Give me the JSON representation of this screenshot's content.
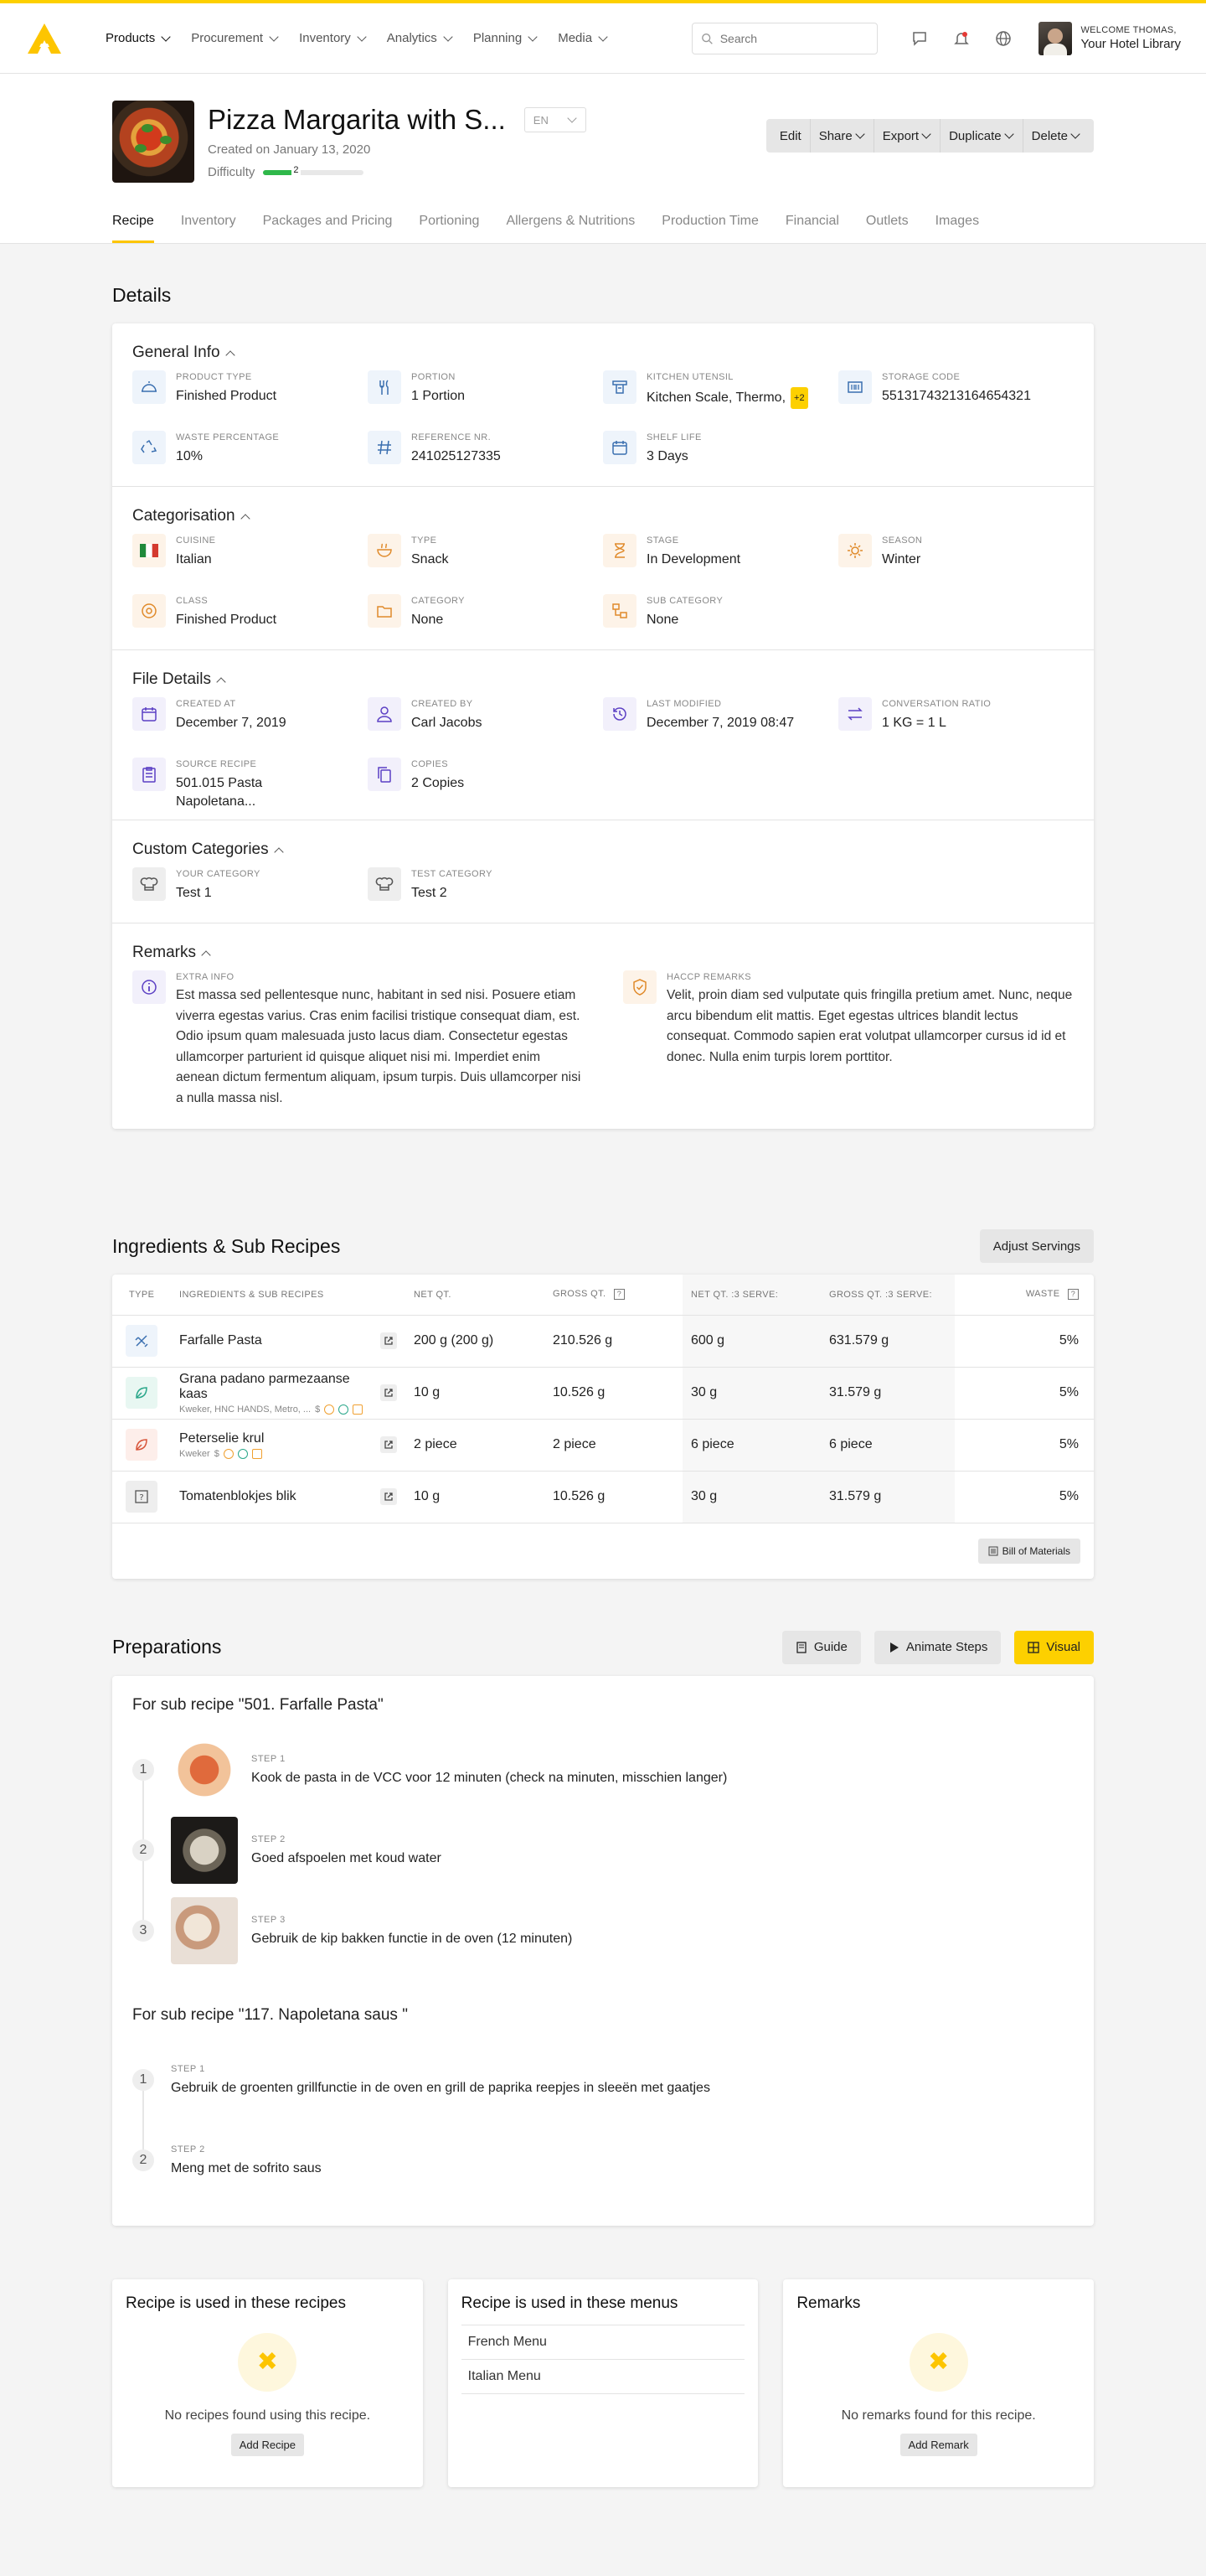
{
  "brand": {
    "accent": "#fdd000",
    "success": "#2fb84a"
  },
  "nav": {
    "items": [
      {
        "label": "Products"
      },
      {
        "label": "Procurement"
      },
      {
        "label": "Inventory"
      },
      {
        "label": "Analytics"
      },
      {
        "label": "Planning"
      },
      {
        "label": "Media"
      }
    ]
  },
  "search": {
    "placeholder": "Search"
  },
  "user": {
    "welcome": "WELCOME THOMAS,",
    "name": "Your Hotel Library"
  },
  "recipe": {
    "title": "Pizza Margarita with S...",
    "created": "Created on January 13, 2020",
    "difficulty_label": "Difficulty",
    "difficulty_value": "2",
    "difficulty_fraction": 0.35,
    "language": "EN",
    "actions": [
      "Edit",
      "Share",
      "Export",
      "Duplicate",
      "Delete"
    ],
    "tabs": [
      "Recipe",
      "Inventory",
      "Packages and Pricing",
      "Portioning",
      "Allergens & Nutritions",
      "Production Time",
      "Financial",
      "Outlets",
      "Images"
    ]
  },
  "details": {
    "title": "Details",
    "general": {
      "title": "General Info",
      "fields": [
        {
          "label": "PRODUCT TYPE",
          "value": "Finished Product",
          "icon": "dome-icon"
        },
        {
          "label": "PORTION",
          "value": "1 Portion",
          "icon": "cutlery-icon"
        },
        {
          "label": "KITCHEN UTENSIL",
          "value": "Kitchen Scale, Thermo,",
          "badge": "+2",
          "icon": "utensil-icon"
        },
        {
          "label": "STORAGE CODE",
          "value": "55131743213164654321",
          "icon": "barcode-icon"
        },
        {
          "label": "WASTE PERCENTAGE",
          "value": "10%",
          "icon": "recycle-icon"
        },
        {
          "label": "REFERENCE NR.",
          "value": "241025127335",
          "icon": "hash-icon"
        },
        {
          "label": "SHELF LIFE",
          "value": "3 Days",
          "icon": "calendar-icon"
        }
      ]
    },
    "categorisation": {
      "title": "Categorisation",
      "fields": [
        {
          "label": "CUISINE",
          "value": "Italian",
          "icon": "flag-italy-icon"
        },
        {
          "label": "TYPE",
          "value": "Snack",
          "icon": "bowl-icon"
        },
        {
          "label": "STAGE",
          "value": "In Development",
          "icon": "hourglass-icon"
        },
        {
          "label": "SEASON",
          "value": "Winter",
          "icon": "sun-icon"
        },
        {
          "label": "CLASS",
          "value": "Finished Product",
          "icon": "badge-icon"
        },
        {
          "label": "CATEGORY",
          "value": "None",
          "icon": "folder-icon"
        },
        {
          "label": "SUB CATEGORY",
          "value": "None",
          "icon": "hierarchy-icon"
        }
      ]
    },
    "file": {
      "title": "File Details",
      "fields": [
        {
          "label": "CREATED AT",
          "value": "December 7, 2019",
          "icon": "calendar-icon"
        },
        {
          "label": "CREATED BY",
          "value": "Carl Jacobs",
          "icon": "user-icon"
        },
        {
          "label": "LAST MODIFIED",
          "value": "December 7, 2019 08:47",
          "icon": "history-icon"
        },
        {
          "label": "CONVERSATION RATIO",
          "value": "1 KG = 1 L",
          "icon": "swap-icon"
        },
        {
          "label": "SOURCE RECIPE",
          "value": "501.015 Pasta Napoletana...",
          "icon": "clipboard-icon"
        },
        {
          "label": "COPIES",
          "value": "2 Copies",
          "icon": "copy-icon"
        }
      ]
    },
    "custom": {
      "title": "Custom Categories",
      "fields": [
        {
          "label": "YOUR CATEGORY",
          "value": "Test 1",
          "icon": "chef-hat-icon"
        },
        {
          "label": "TEST CATEGORY",
          "value": "Test 2",
          "icon": "chef-hat-icon"
        }
      ]
    },
    "remarks": {
      "title": "Remarks",
      "items": [
        {
          "label": "EXTRA INFO",
          "text": "Est massa sed pellentesque nunc, habitant in sed nisi. Posuere etiam viverra egestas varius. Cras enim facilisi tristique consequat diam, est. Odio ipsum quam malesuada justo lacus diam. Consectetur egestas ullamcorper parturient id quisque aliquet nisi mi. Imperdiet enim aenean dictum fermentum aliquam, ipsum turpis. Duis ullamcorper nisi a nulla massa nisl.",
          "icon": "info-icon"
        },
        {
          "label": "HACCP REMARKS",
          "text": "Velit, proin diam sed vulputate quis fringilla pretium amet. Nunc, neque arcu bibendum elit mattis. Eget egestas ultrices blandit lectus consequat. Commodo sapien erat volutpat ullamcorper cursus id id et donec. Nulla enim turpis lorem porttitor.",
          "icon": "shield-check-icon"
        }
      ]
    }
  },
  "ingredients": {
    "title": "Ingredients & Sub Recipes",
    "adjust_label": "Adjust Servings",
    "headers": [
      "TYPE",
      "INGREDIENTS & SUB RECIPES",
      "NET QT.",
      "GROSS QT.",
      "NET QT. :3 SERVE:",
      "GROSS QT. :3 SERVE:",
      "WASTE"
    ],
    "rows": [
      {
        "name": "Farfalle Pasta",
        "sub": "",
        "net": "200 g (200 g)",
        "gross": "210.526 g",
        "net3": "600 g",
        "gross3": "631.579 g",
        "waste": "5%",
        "icon": "pasta-icon",
        "tint": "#eef4fb"
      },
      {
        "name": "Grana padano parmezaanse kaas",
        "sub": "Kweker, HNC HANDS, Metro, ...",
        "net": "10 g",
        "gross": "10.526 g",
        "net3": "30 g",
        "gross3": "31.579 g",
        "waste": "5%",
        "icon": "leaf-icon",
        "tint": "#e8f7f2"
      },
      {
        "name": "Peterselie krul",
        "sub": "Kweker",
        "net": "2 piece",
        "gross": "2 piece",
        "net3": "6 piece",
        "gross3": "6 piece",
        "waste": "5%",
        "icon": "leaf-icon",
        "tint": "#fdeeea"
      },
      {
        "name": "Tomatenblokjes blik",
        "sub": "",
        "net": "10 g",
        "gross": "10.526 g",
        "net3": "30 g",
        "gross3": "31.579 g",
        "waste": "5%",
        "icon": "question-icon",
        "tint": "#eeeeee"
      }
    ],
    "bom_label": "Bill of Materials"
  },
  "preparations": {
    "title": "Preparations",
    "guide_label": "Guide",
    "animate_label": "Animate Steps",
    "visual_label": "Visual",
    "groups": [
      {
        "title": "For sub recipe \"501. Farfalle Pasta\"",
        "steps": [
          {
            "num": "1",
            "label": "STEP 1",
            "text": "Kook de pasta in de VCC voor 12 minuten (check na minuten, misschien langer)"
          },
          {
            "num": "2",
            "label": "STEP 2",
            "text": "Goed afspoelen met koud water"
          },
          {
            "num": "3",
            "label": "STEP 3",
            "text": "Gebruik de kip bakken functie in de oven (12 minuten)"
          }
        ]
      },
      {
        "title": "For sub recipe \"117. Napoletana saus \"",
        "steps": [
          {
            "num": "1",
            "label": "STEP 1",
            "text": "Gebruik de groenten grillfunctie in de oven en grill de paprika reepjes in sleeën met gaatjes"
          },
          {
            "num": "2",
            "label": "STEP 2",
            "text": "Meng met de sofrito saus"
          }
        ]
      }
    ]
  },
  "bottom": {
    "used_in_recipes": {
      "title": "Recipe is used in these recipes",
      "empty": "No recipes found using this recipe.",
      "button": "Add Recipe"
    },
    "used_in_menus": {
      "title": "Recipe is used in these menus",
      "items": [
        "French Menu",
        "Italian Menu"
      ]
    },
    "remarks": {
      "title": "Remarks",
      "empty": "No remarks found for this recipe.",
      "button": "Add Remark"
    }
  }
}
